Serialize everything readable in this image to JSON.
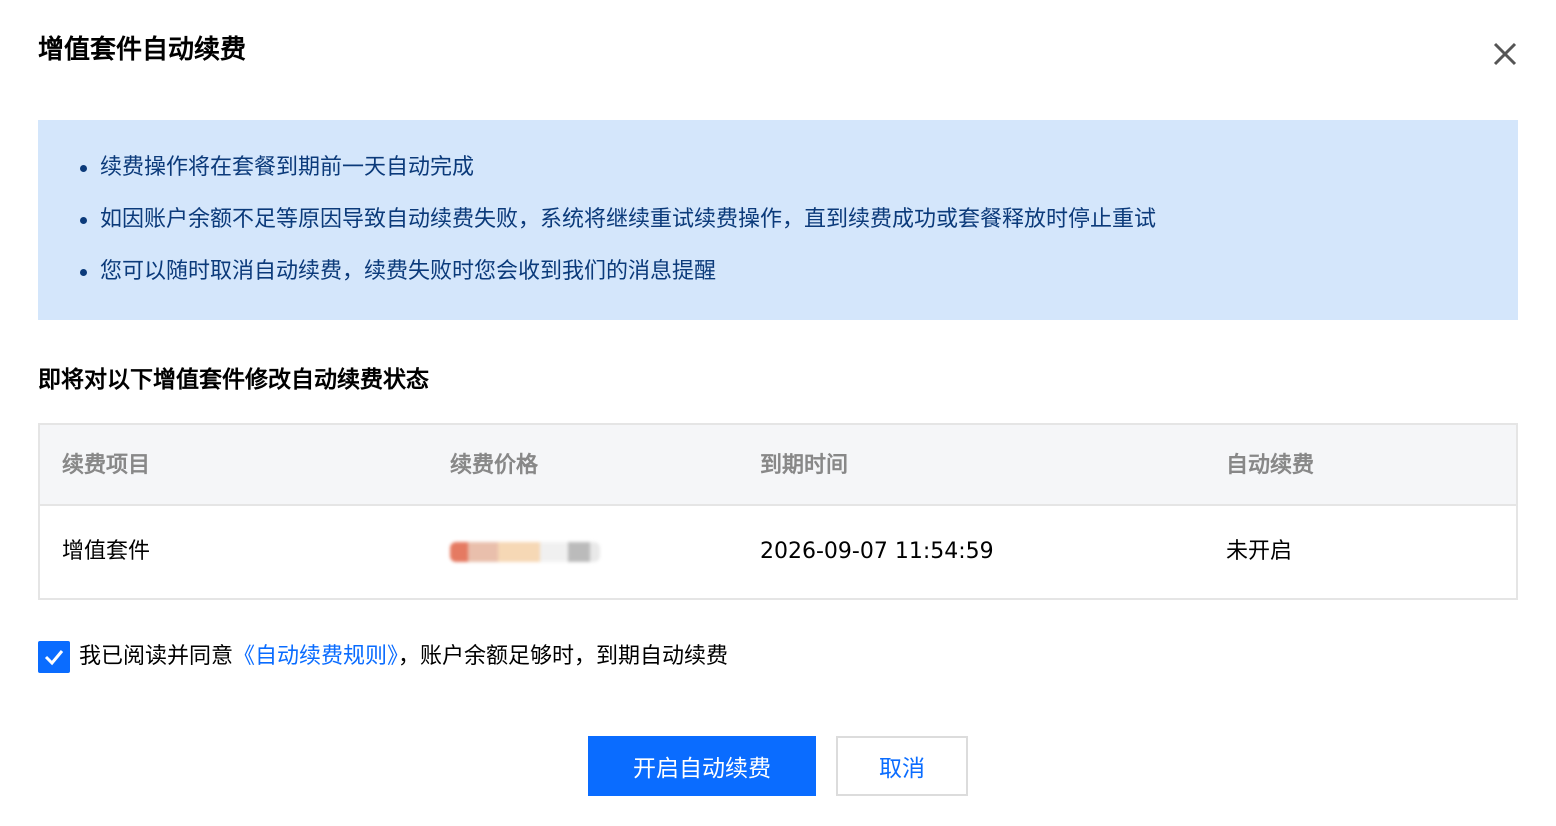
{
  "dialog": {
    "title": "增值套件自动续费"
  },
  "notice": {
    "items": [
      "续费操作将在套餐到期前一天自动完成",
      "如因账户余额不足等原因导致自动续费失败，系统将继续重试续费操作，直到续费成功或套餐释放时停止重试",
      "您可以随时取消自动续费，续费失败时您会收到我们的消息提醒"
    ]
  },
  "section": {
    "title": "即将对以下增值套件修改自动续费状态"
  },
  "table": {
    "headers": [
      "续费项目",
      "续费价格",
      "到期时间",
      "自动续费"
    ],
    "rows": [
      {
        "item": "增值套件",
        "price": "",
        "expire": "2026-09-07 11:54:59",
        "auto_renew": "未开启"
      }
    ]
  },
  "agreement": {
    "checked": true,
    "prefix": "我已阅读并同意",
    "link": "《自动续费规则》",
    "suffix": "，账户余额足够时，到期自动续费"
  },
  "buttons": {
    "confirm": "开启自动续费",
    "cancel": "取消"
  },
  "colors": {
    "primary": "#0a6cff",
    "notice_bg": "#d4e6fb",
    "notice_text": "#0b3a7a"
  },
  "icons": {
    "close": "close-icon",
    "check": "check-icon"
  }
}
